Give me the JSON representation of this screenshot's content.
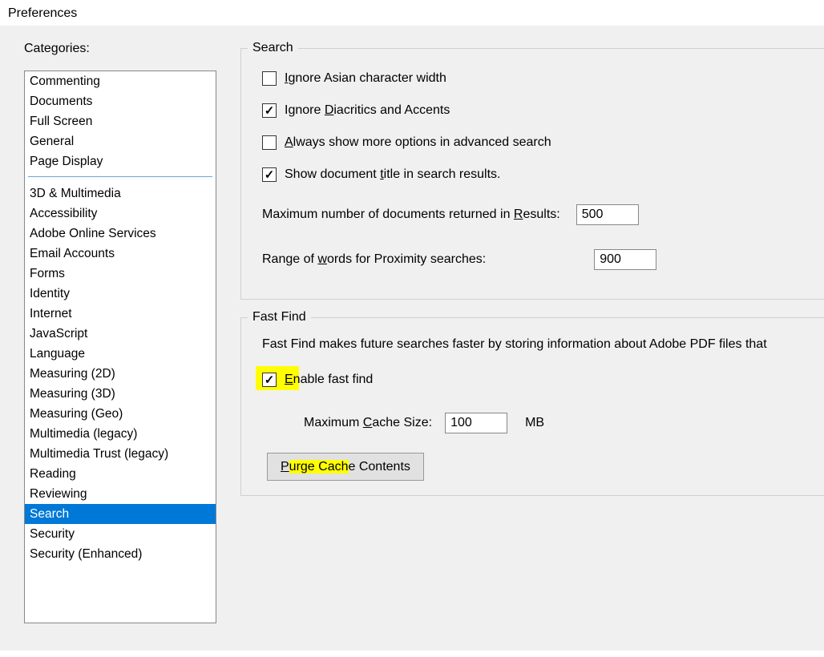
{
  "window": {
    "title": "Preferences"
  },
  "sidebar": {
    "label": "Categories:",
    "groupA": [
      "Commenting",
      "Documents",
      "Full Screen",
      "General",
      "Page Display"
    ],
    "groupB": [
      "3D & Multimedia",
      "Accessibility",
      "Adobe Online Services",
      "Email Accounts",
      "Forms",
      "Identity",
      "Internet",
      "JavaScript",
      "Language",
      "Measuring (2D)",
      "Measuring (3D)",
      "Measuring (Geo)",
      "Multimedia (legacy)",
      "Multimedia Trust (legacy)",
      "Reading",
      "Reviewing",
      "Search",
      "Security",
      "Security (Enhanced)"
    ],
    "selected": "Search"
  },
  "search": {
    "group_title": "Search",
    "ignore_asian": {
      "label_pre": "",
      "label_u": "I",
      "label_post": "gnore Asian character width",
      "checked": false
    },
    "ignore_diacritics": {
      "label_pre": "Ignore ",
      "label_u": "D",
      "label_post": "iacritics and Accents",
      "checked": true
    },
    "always_more": {
      "label_pre": "",
      "label_u": "A",
      "label_post": "lways show more options in advanced search",
      "checked": false
    },
    "show_title": {
      "label_pre": "Show document ",
      "label_u": "t",
      "label_post": "itle in search results.",
      "checked": true
    },
    "max_docs": {
      "label_pre": "Maximum number of documents returned in ",
      "label_u": "R",
      "label_post": "esults:",
      "value": "500"
    },
    "proximity": {
      "label_pre": "Range of ",
      "label_u": "w",
      "label_post": "ords for Proximity searches:",
      "value": "900"
    }
  },
  "fastfind": {
    "group_title": "Fast Find",
    "description": "Fast Find makes future searches faster by storing information about Adobe PDF files that",
    "enable": {
      "label_u": "E",
      "label_post": "nable fast find",
      "checked": true
    },
    "cache": {
      "label_pre": "Maximum ",
      "label_u": "C",
      "label_post": "ache Size:",
      "value": "100",
      "unit": "MB"
    },
    "purge": {
      "label_u": "P",
      "label_mid_hl": "urge Cach",
      "label_post": "e Contents"
    }
  }
}
